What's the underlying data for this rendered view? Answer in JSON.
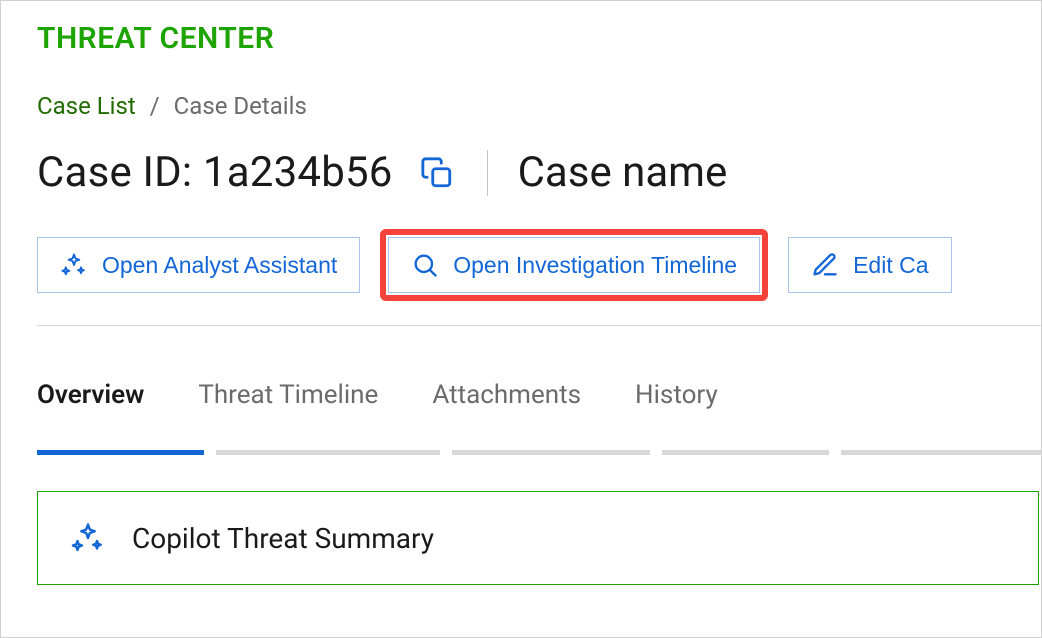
{
  "page": {
    "title": "THREAT CENTER"
  },
  "breadcrumb": {
    "link": "Case List",
    "separator": "/",
    "current": "Case Details"
  },
  "header": {
    "case_id_label": "Case ID: 1a234b56",
    "case_name": "Case name"
  },
  "actions": {
    "analyst_assistant": "Open Analyst Assistant",
    "investigation_timeline": "Open Investigation Timeline",
    "edit_case": "Edit Ca"
  },
  "tabs": {
    "overview": "Overview",
    "threat_timeline": "Threat Timeline",
    "attachments": "Attachments",
    "history": "History"
  },
  "summary": {
    "title": "Copilot Threat Summary"
  },
  "highlighted_action": "investigation_timeline"
}
